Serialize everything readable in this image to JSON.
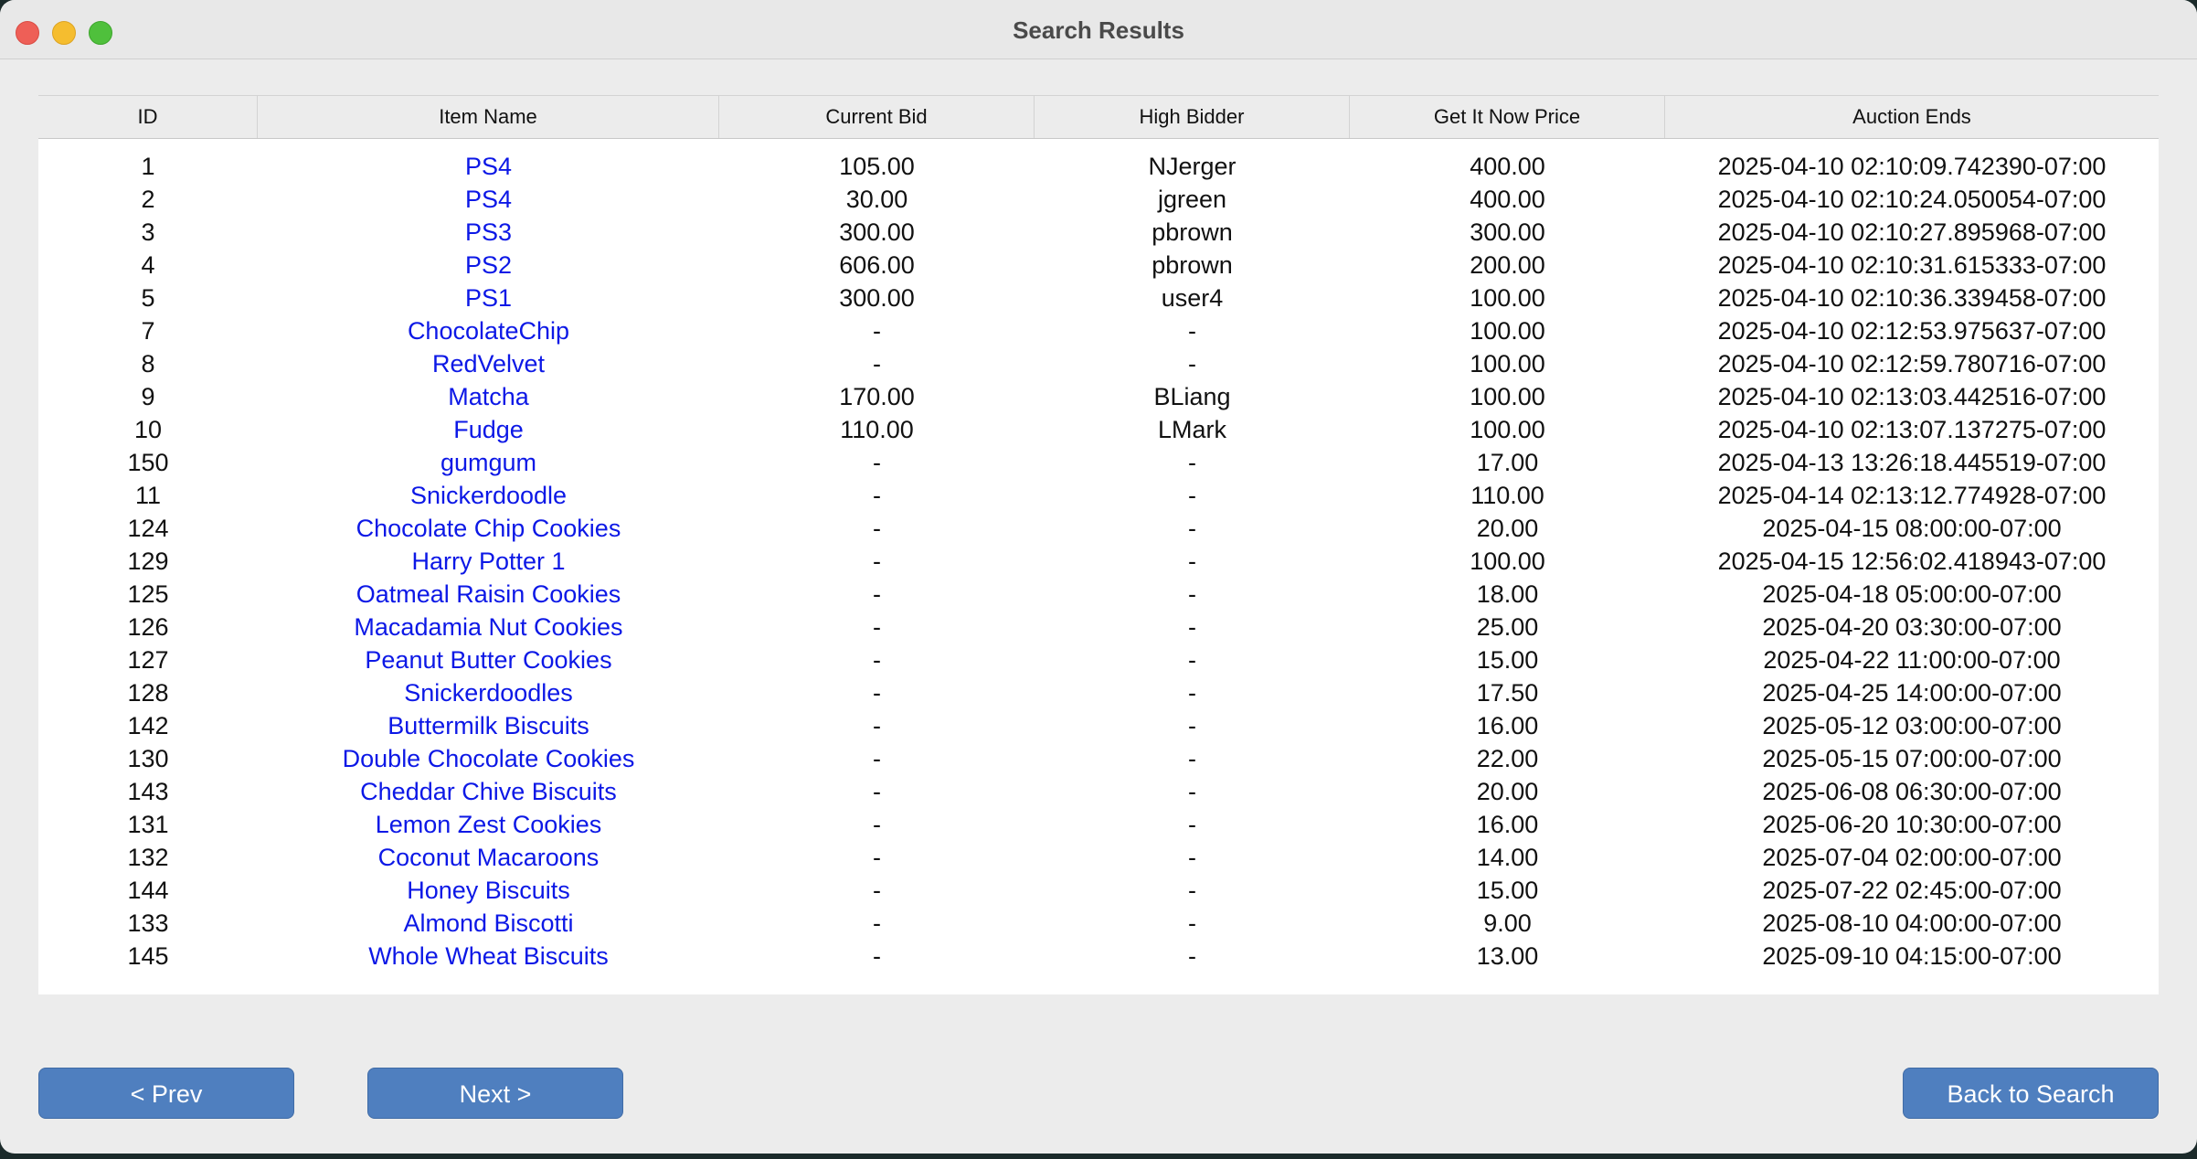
{
  "window": {
    "title": "Search Results"
  },
  "table": {
    "headers": [
      "ID",
      "Item Name",
      "Current Bid",
      "High Bidder",
      "Get It Now Price",
      "Auction Ends"
    ],
    "rows": [
      {
        "id": "1",
        "name": "PS4",
        "bid": "105.00",
        "bidder": "NJerger",
        "price": "400.00",
        "ends": "2025-04-10 02:10:09.742390-07:00"
      },
      {
        "id": "2",
        "name": "PS4",
        "bid": "30.00",
        "bidder": "jgreen",
        "price": "400.00",
        "ends": "2025-04-10 02:10:24.050054-07:00"
      },
      {
        "id": "3",
        "name": "PS3",
        "bid": "300.00",
        "bidder": "pbrown",
        "price": "300.00",
        "ends": "2025-04-10 02:10:27.895968-07:00"
      },
      {
        "id": "4",
        "name": "PS2",
        "bid": "606.00",
        "bidder": "pbrown",
        "price": "200.00",
        "ends": "2025-04-10 02:10:31.615333-07:00"
      },
      {
        "id": "5",
        "name": "PS1",
        "bid": "300.00",
        "bidder": "user4",
        "price": "100.00",
        "ends": "2025-04-10 02:10:36.339458-07:00"
      },
      {
        "id": "7",
        "name": "ChocolateChip",
        "bid": "-",
        "bidder": "-",
        "price": "100.00",
        "ends": "2025-04-10 02:12:53.975637-07:00"
      },
      {
        "id": "8",
        "name": "RedVelvet",
        "bid": "-",
        "bidder": "-",
        "price": "100.00",
        "ends": "2025-04-10 02:12:59.780716-07:00"
      },
      {
        "id": "9",
        "name": "Matcha",
        "bid": "170.00",
        "bidder": "BLiang",
        "price": "100.00",
        "ends": "2025-04-10 02:13:03.442516-07:00"
      },
      {
        "id": "10",
        "name": "Fudge",
        "bid": "110.00",
        "bidder": "LMark",
        "price": "100.00",
        "ends": "2025-04-10 02:13:07.137275-07:00"
      },
      {
        "id": "150",
        "name": "gumgum",
        "bid": "-",
        "bidder": "-",
        "price": "17.00",
        "ends": "2025-04-13 13:26:18.445519-07:00"
      },
      {
        "id": "11",
        "name": "Snickerdoodle",
        "bid": "-",
        "bidder": "-",
        "price": "110.00",
        "ends": "2025-04-14 02:13:12.774928-07:00"
      },
      {
        "id": "124",
        "name": "Chocolate Chip Cookies",
        "bid": "-",
        "bidder": "-",
        "price": "20.00",
        "ends": "2025-04-15 08:00:00-07:00"
      },
      {
        "id": "129",
        "name": "Harry Potter 1",
        "bid": "-",
        "bidder": "-",
        "price": "100.00",
        "ends": "2025-04-15 12:56:02.418943-07:00"
      },
      {
        "id": "125",
        "name": "Oatmeal Raisin Cookies",
        "bid": "-",
        "bidder": "-",
        "price": "18.00",
        "ends": "2025-04-18 05:00:00-07:00"
      },
      {
        "id": "126",
        "name": "Macadamia Nut Cookies",
        "bid": "-",
        "bidder": "-",
        "price": "25.00",
        "ends": "2025-04-20 03:30:00-07:00"
      },
      {
        "id": "127",
        "name": "Peanut Butter Cookies",
        "bid": "-",
        "bidder": "-",
        "price": "15.00",
        "ends": "2025-04-22 11:00:00-07:00"
      },
      {
        "id": "128",
        "name": "Snickerdoodles",
        "bid": "-",
        "bidder": "-",
        "price": "17.50",
        "ends": "2025-04-25 14:00:00-07:00"
      },
      {
        "id": "142",
        "name": "Buttermilk Biscuits",
        "bid": "-",
        "bidder": "-",
        "price": "16.00",
        "ends": "2025-05-12 03:00:00-07:00"
      },
      {
        "id": "130",
        "name": "Double Chocolate Cookies",
        "bid": "-",
        "bidder": "-",
        "price": "22.00",
        "ends": "2025-05-15 07:00:00-07:00"
      },
      {
        "id": "143",
        "name": "Cheddar Chive Biscuits",
        "bid": "-",
        "bidder": "-",
        "price": "20.00",
        "ends": "2025-06-08 06:30:00-07:00"
      },
      {
        "id": "131",
        "name": "Lemon Zest Cookies",
        "bid": "-",
        "bidder": "-",
        "price": "16.00",
        "ends": "2025-06-20 10:30:00-07:00"
      },
      {
        "id": "132",
        "name": "Coconut Macaroons",
        "bid": "-",
        "bidder": "-",
        "price": "14.00",
        "ends": "2025-07-04 02:00:00-07:00"
      },
      {
        "id": "144",
        "name": "Honey Biscuits",
        "bid": "-",
        "bidder": "-",
        "price": "15.00",
        "ends": "2025-07-22 02:45:00-07:00"
      },
      {
        "id": "133",
        "name": "Almond Biscotti",
        "bid": "-",
        "bidder": "-",
        "price": "9.00",
        "ends": "2025-08-10 04:00:00-07:00"
      },
      {
        "id": "145",
        "name": "Whole Wheat Biscuits",
        "bid": "-",
        "bidder": "-",
        "price": "13.00",
        "ends": "2025-09-10 04:15:00-07:00"
      }
    ]
  },
  "buttons": {
    "prev_label": "< Prev",
    "next_label": "Next >",
    "back_label": "Back to Search"
  },
  "colors": {
    "link": "#0c18e6",
    "button": "#4f7fbf",
    "close": "#ee5f57",
    "minimize": "#f5bd2f",
    "maximize": "#4fc03c"
  }
}
